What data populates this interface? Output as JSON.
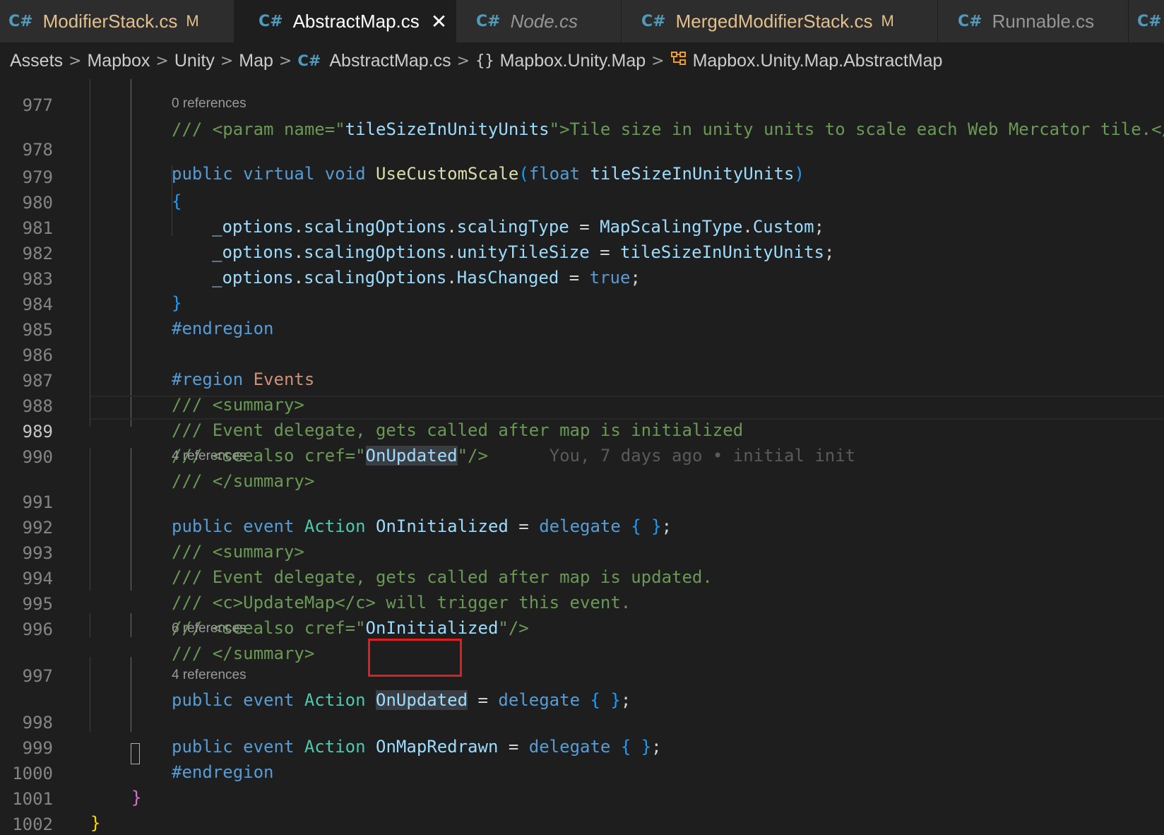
{
  "tabs": [
    {
      "icon": "C#",
      "name": "ModifierStack.cs",
      "badge": "M",
      "state": "modified"
    },
    {
      "icon": "C#",
      "name": "AbstractMap.cs",
      "close": "✕",
      "state": "active"
    },
    {
      "icon": "C#",
      "name": "Node.cs",
      "state": "preview"
    },
    {
      "icon": "C#",
      "name": "MergedModifierStack.cs",
      "badge": "M",
      "state": "modified"
    },
    {
      "icon": "C#",
      "name": "Runnable.cs",
      "state": "normal"
    }
  ],
  "breadcrumb": {
    "items": [
      "Assets",
      "Mapbox",
      "Unity",
      "Map"
    ],
    "file_icon": "C#",
    "file": "AbstractMap.cs",
    "namespace_icon": "{}",
    "namespace": "Mapbox.Unity.Map",
    "class_icon": "class-icon",
    "class": "Mapbox.Unity.Map.AbstractMap",
    "separator": ">"
  },
  "editor": {
    "current_line": "989",
    "line_numbers": [
      "977",
      "978",
      "979",
      "980",
      "981",
      "982",
      "983",
      "984",
      "985",
      "986",
      "987",
      "988",
      "989",
      "990",
      "991",
      "992",
      "993",
      "994",
      "995",
      "996",
      "997",
      "998",
      "999",
      "1000",
      "1001",
      "1002"
    ],
    "code_lens": {
      "l978": "0 references",
      "l991": "4 references",
      "l997": "6 references",
      "l998": "4 references"
    },
    "blame": "You, 7 days ago • initial init",
    "lines": {
      "l977": {
        "a": "/// <param name=\"",
        "b": "tileSizeInUnityUnits",
        "c": "\">Tile size in unity units to scale each Web Mercator tile.</"
      },
      "l978": {
        "a": "public",
        "b": "virtual",
        "c": "void",
        "d": "UseCustomScale",
        "e": "(",
        "f": "float",
        "g": "tileSizeInUnityUnits",
        "h": ")"
      },
      "l979": {
        "a": "{"
      },
      "l980": {
        "a": "_options",
        "b": ".",
        "c": "scalingOptions",
        "d": ".",
        "e": "scalingType",
        "f": " = ",
        "g": "MapScalingType",
        "h": ".",
        "i": "Custom",
        "j": ";"
      },
      "l981": {
        "a": "_options",
        "b": ".",
        "c": "scalingOptions",
        "d": ".",
        "e": "unityTileSize",
        "f": " = ",
        "g": "tileSizeInUnityUnits",
        "h": ";"
      },
      "l982": {
        "a": "_options",
        "b": ".",
        "c": "scalingOptions",
        "d": ".",
        "e": "HasChanged",
        "f": " = ",
        "g": "true",
        "h": ";"
      },
      "l983": {
        "a": "}"
      },
      "l984": {
        "a": "#endregion"
      },
      "l986": {
        "a": "#region",
        "b": "Events"
      },
      "l987": {
        "a": "/// <summary>"
      },
      "l988": {
        "a": "/// Event delegate, gets called after map is initialized"
      },
      "l989": {
        "a": "/// <seealso cref=\"",
        "b": "OnUpdated",
        "c": "\"/>"
      },
      "l990": {
        "a": "/// </summary>"
      },
      "l991": {
        "a": "public",
        "b": "event",
        "c": "Action",
        "d": "OnInitialized",
        "e": " = ",
        "f": "delegate",
        "g": "{ }",
        "h": ";"
      },
      "l992": {
        "a": "/// <summary>"
      },
      "l993": {
        "a": "/// Event delegate, gets called after map is updated."
      },
      "l994": {
        "a": "/// <c>UpdateMap</c> will trigger this event."
      },
      "l995": {
        "a": "/// <seealso cref=\"",
        "b": "OnInitialized",
        "c": "\"/>"
      },
      "l996": {
        "a": "/// </summary>"
      },
      "l997": {
        "a": "public",
        "b": "event",
        "c": "Action",
        "d": "OnUpdated",
        "e": " = ",
        "f": "delegate",
        "g": "{ }",
        "h": ";"
      },
      "l998": {
        "a": "public",
        "b": "event",
        "c": "Action",
        "d": "OnMapRedrawn",
        "e": " = ",
        "f": "delegate",
        "g": "{ }",
        "h": ";"
      },
      "l999": {
        "a": "#endregion"
      },
      "l1000": {
        "a": "}"
      },
      "l1001": {
        "a": "}"
      }
    }
  }
}
